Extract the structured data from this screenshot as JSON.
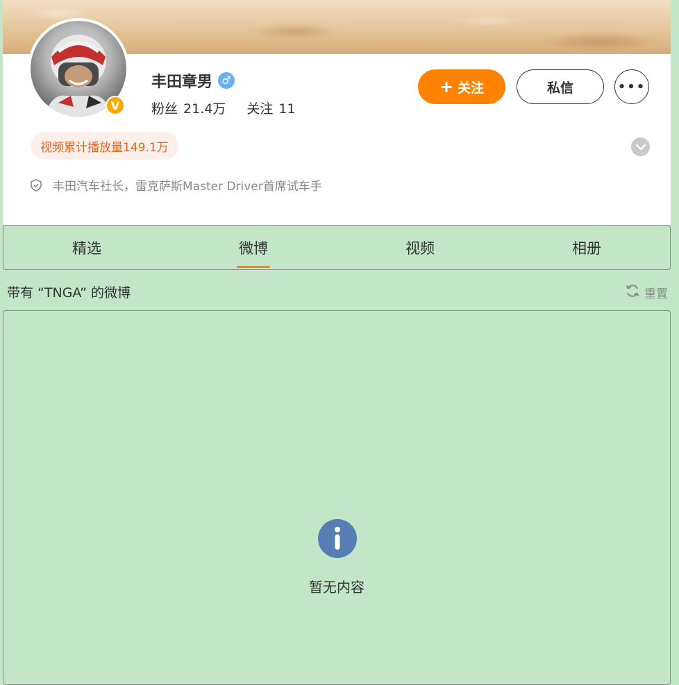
{
  "profile": {
    "name": "丰田章男",
    "gender_icon": "male-icon",
    "followers_label": "粉丝",
    "followers_count": "21.4万",
    "following_label": "关注",
    "following_count": "11",
    "verified_badge_text": "V",
    "views_pill": "视频累计播放量149.1万",
    "bio": "丰田汽车社长，雷克萨斯Master Driver首席试车手"
  },
  "actions": {
    "follow_plus": "+",
    "follow_label": "关注",
    "message_label": "私信",
    "more_label": "•••"
  },
  "tabs": [
    {
      "label": "精选",
      "active": false
    },
    {
      "label": "微博",
      "active": true
    },
    {
      "label": "视频",
      "active": false
    },
    {
      "label": "相册",
      "active": false
    }
  ],
  "filter": {
    "title": "带有 “TNGA” 的微博",
    "reset_label": "重置"
  },
  "empty_state": {
    "icon": "info-icon",
    "text": "暂无内容"
  },
  "colors": {
    "page_background": "#c2e6c7",
    "accent": "#ff8200",
    "verified": "#f7a900",
    "gender": "#6ab0f3",
    "info_icon": "#567eb3",
    "views_pill_text": "#e8641c"
  }
}
